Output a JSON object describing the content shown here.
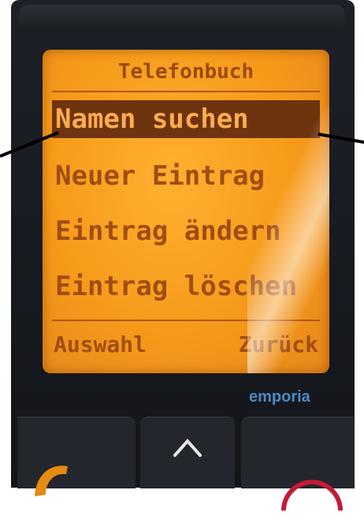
{
  "screen": {
    "title": "Telefonbuch",
    "menu": [
      {
        "label": "Namen suchen",
        "selected": true
      },
      {
        "label": "Neuer Eintrag",
        "selected": false
      },
      {
        "label": "Eintrag ändern",
        "selected": false
      },
      {
        "label": "Eintrag löschen",
        "selected": false
      }
    ],
    "softkeys": {
      "left": "Auswahl",
      "right": "Zurück"
    }
  },
  "device": {
    "brand": "emporia"
  },
  "keys": {
    "up_glyph": "^"
  },
  "colors": {
    "screen_bg": "#f79a1a",
    "text": "#a04d12",
    "selection_bg": "#6e3410",
    "brand": "#4a8ac4"
  }
}
